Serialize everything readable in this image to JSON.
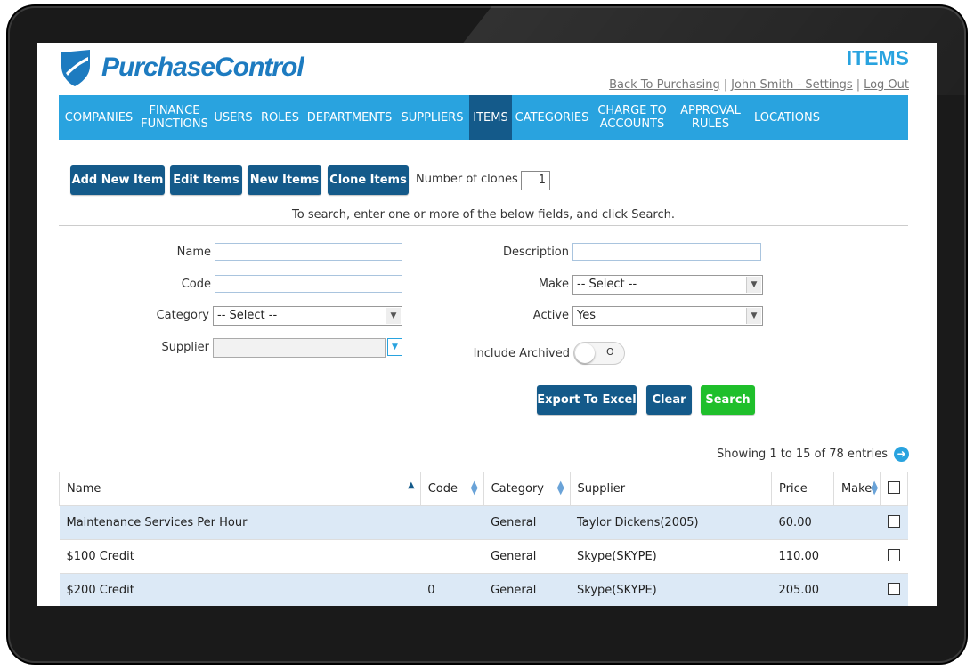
{
  "brand": {
    "name": "PurchaseControl"
  },
  "page": {
    "title": "ITEMS"
  },
  "top_links": {
    "back": "Back To Purchasing",
    "user": "John Smith - Settings",
    "logout": "Log Out"
  },
  "nav": {
    "companies": "COMPANIES",
    "finance_1": "FINANCE",
    "finance_2": "FUNCTIONS",
    "users": "USERS",
    "roles": "ROLES",
    "departments": "DEPARTMENTS",
    "suppliers": "SUPPLIERS",
    "items": "ITEMS",
    "categories": "CATEGORIES",
    "charge_1": "CHARGE TO",
    "charge_2": "ACCOUNTS",
    "approval_1": "APPROVAL",
    "approval_2": "RULES",
    "locations": "LOCATIONS"
  },
  "toolbar": {
    "add_new_item": "Add New Item",
    "edit_items": "Edit Items",
    "new_items": "New Items",
    "clone_items": "Clone Items",
    "num_clones_label": "Number of clones",
    "num_clones_value": "1"
  },
  "search": {
    "hint": "To search, enter one or more of the below fields, and click Search.",
    "name_label": "Name",
    "code_label": "Code",
    "category_label": "Category",
    "category_value": "-- Select --",
    "supplier_label": "Supplier",
    "description_label": "Description",
    "make_label": "Make",
    "make_value": "-- Select --",
    "active_label": "Active",
    "active_value": "Yes",
    "include_archived_label": "Include Archived",
    "include_archived_state": "O",
    "export_label": "Export To Excel",
    "clear_label": "Clear",
    "search_label": "Search"
  },
  "results": {
    "showing": "Showing 1 to 15 of 78 entries"
  },
  "table": {
    "headers": {
      "name": "Name",
      "code": "Code",
      "category": "Category",
      "supplier": "Supplier",
      "price": "Price",
      "make": "Make"
    },
    "rows": [
      {
        "name": "Maintenance Services Per Hour",
        "code": "",
        "category": "General",
        "supplier": "Taylor Dickens(2005)",
        "price": "60.00",
        "make": ""
      },
      {
        "name": "$100 Credit",
        "code": "",
        "category": "General",
        "supplier": "Skype(SKYPE)",
        "price": "110.00",
        "make": ""
      },
      {
        "name": "$200 Credit",
        "code": "0",
        "category": "General",
        "supplier": "Skype(SKYPE)",
        "price": "205.00",
        "make": ""
      }
    ]
  },
  "colors": {
    "nav_bg": "#29a3df",
    "nav_active": "#145a8a",
    "primary_btn": "#145a8a",
    "search_btn": "#1fbf2b",
    "row_alt": "#dce9f6"
  }
}
